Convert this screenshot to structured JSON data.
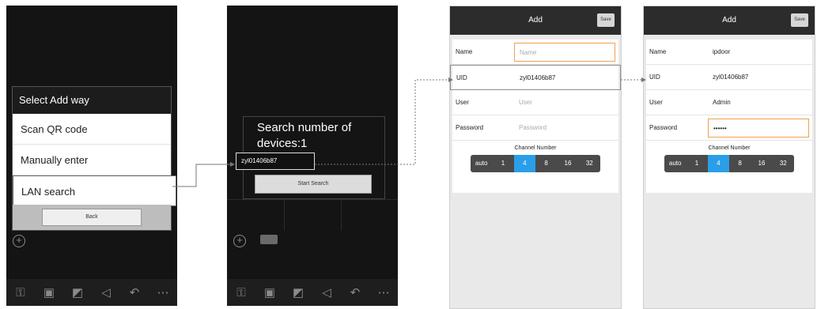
{
  "screen1": {
    "dialog_title": "Select Add way",
    "options": [
      "Scan QR code",
      "Manually enter",
      "LAN search"
    ],
    "back_label": "Back",
    "toolbar_icons": [
      "key-icon",
      "camera-icon",
      "snapshot-icon",
      "audio-icon",
      "return-icon",
      "more-icon"
    ]
  },
  "screen2": {
    "search_text": "Search number of devices:1",
    "found_uid": "zyl01406b87",
    "start_search_label": "Start Search"
  },
  "screen3": {
    "title": "Add",
    "save_label": "Save",
    "fields": [
      {
        "label": "Name",
        "value": "",
        "placeholder": "Name"
      },
      {
        "label": "UID",
        "value": "zyl01406b87",
        "placeholder": ""
      },
      {
        "label": "User",
        "value": "",
        "placeholder": "User"
      },
      {
        "label": "Password",
        "value": "",
        "placeholder": "Password"
      }
    ],
    "channel_title": "Channel Number",
    "channels": [
      "auto",
      "1",
      "4",
      "8",
      "16",
      "32"
    ],
    "active_channel": "4"
  },
  "screen4": {
    "title": "Add",
    "save_label": "Save",
    "fields": [
      {
        "label": "Name",
        "value": "ipdoor"
      },
      {
        "label": "UID",
        "value": "zyl01406b87"
      },
      {
        "label": "User",
        "value": "Admin"
      },
      {
        "label": "Password",
        "value": "••••••"
      }
    ],
    "channel_title": "Channel Number",
    "channels": [
      "auto",
      "1",
      "4",
      "8",
      "16",
      "32"
    ],
    "active_channel": "4"
  }
}
